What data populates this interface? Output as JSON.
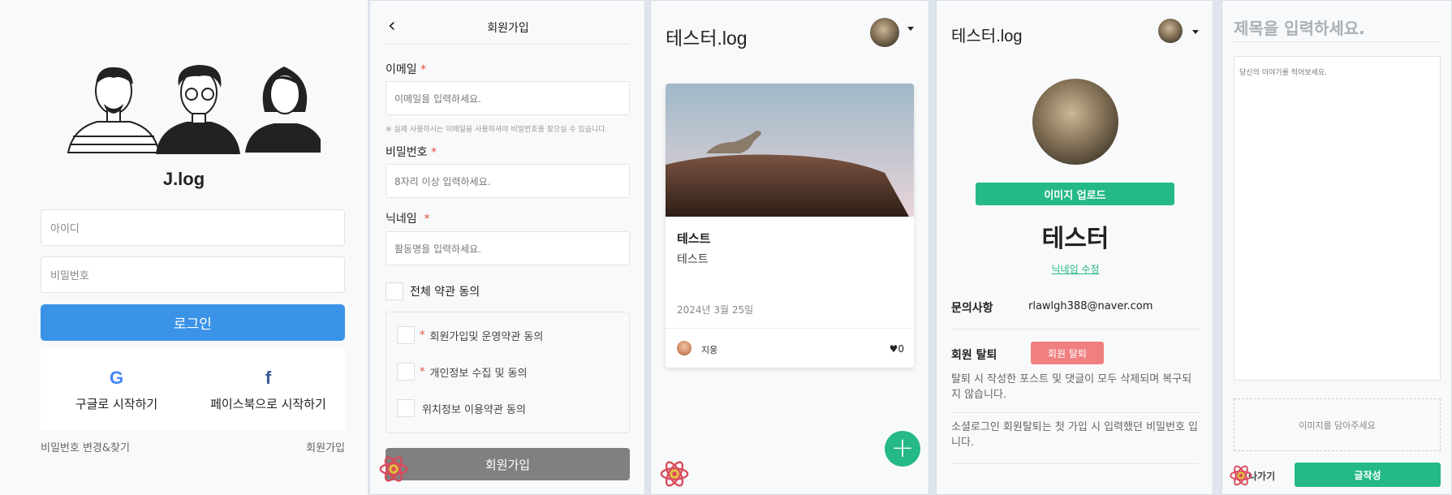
{
  "login": {
    "title": "J.log",
    "id_placeholder": "아이디",
    "pw_placeholder": "비밀번호",
    "login_button": "로그인",
    "google_label": "구글로 시작하기",
    "facebook_label": "페이스북으로 시작하기",
    "google_glyph": "G",
    "facebook_glyph": "f",
    "find_password": "비밀번호 변경&찾기",
    "signup_link": "회원가입"
  },
  "signup": {
    "back_glyph": "‹",
    "title": "회원가입",
    "email_label": "이메일",
    "email_placeholder": "이메일을 입력하세요.",
    "email_note": "※ 실제 사용하시는 이메일을 사용하셔야 비밀번호를 찾으실 수 있습니다.",
    "password_label": "비밀번호",
    "password_placeholder": "8자리 이상 입력하세요.",
    "nickname_label": "닉네임",
    "nickname_placeholder": "활동명을 입력하세요.",
    "required_mark": "*",
    "agree_all": "전체 약관 동의",
    "terms": [
      {
        "required": true,
        "label": "회원가입및 운영약관 동의"
      },
      {
        "required": true,
        "label": "개인정보 수집 및 동의"
      },
      {
        "required": false,
        "label": "위치정보 이용약관 동의"
      }
    ],
    "submit_button": "회원가입"
  },
  "feed": {
    "title": "테스터.log",
    "card": {
      "title": "테스트",
      "summary": "테스트",
      "date": "2024년 3월 25일",
      "author": "지웅",
      "likes": "♥0"
    },
    "fab_glyph": "+"
  },
  "profile": {
    "title": "테스터.log",
    "upload_button": "이미지 업로드",
    "nickname": "테스터",
    "edit_nickname": "닉네임 수정",
    "contact_label": "문의사항",
    "contact_value": "rlawlgh388@naver.com",
    "withdraw_label": "회원 탈퇴",
    "withdraw_button": "회원 탈퇴",
    "notice1": "탈퇴 시 작성한 포스트 및 댓글이 모두 삭제되며 복구되지 않습니다.",
    "notice2": "소셜로그인 회원탈퇴는 첫 가입 시 입력했던 비밀번호 입니다."
  },
  "write": {
    "title_placeholder": "제목을 입력하세요.",
    "body_placeholder": "당신의 이야기를 적어보세요.",
    "image_drop": "이미지를 담아주세요",
    "back_label": "나가기",
    "submit_button": "글작성"
  },
  "colors": {
    "blue": "#3a93e6",
    "green": "#25b889",
    "pink": "#f08080",
    "gray_button": "#808080"
  }
}
